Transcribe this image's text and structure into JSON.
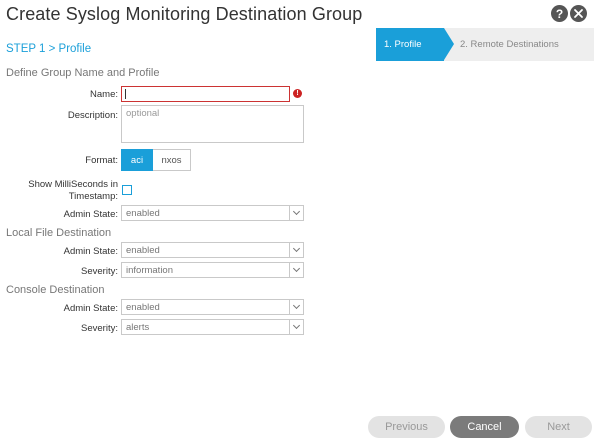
{
  "dialog": {
    "title": "Create Syslog Monitoring Destination Group",
    "help_icon": "?",
    "close_icon": "x-circle"
  },
  "wizard": {
    "steps": [
      {
        "label": "1. Profile",
        "active": true
      },
      {
        "label": "2. Remote Destinations",
        "active": false
      }
    ],
    "breadcrumb": "STEP 1 > Profile"
  },
  "sections": {
    "group": "Define Group Name and Profile",
    "local_file": "Local File Destination",
    "console": "Console Destination"
  },
  "form": {
    "name": {
      "label": "Name:",
      "value": "",
      "error": "!"
    },
    "description": {
      "label": "Description:",
      "placeholder": "optional"
    },
    "format": {
      "label": "Format:",
      "options": [
        "aci",
        "nxos"
      ],
      "selected": "aci"
    },
    "show_ms": {
      "label_line1": "Show MilliSeconds in",
      "label_line2": "Timestamp:",
      "checked": false
    },
    "admin_state": {
      "label": "Admin State:",
      "value": "enabled"
    },
    "local_admin_state": {
      "label": "Admin State:",
      "value": "enabled"
    },
    "local_severity": {
      "label": "Severity:",
      "value": "information"
    },
    "console_admin_state": {
      "label": "Admin State:",
      "value": "enabled"
    },
    "console_severity": {
      "label": "Severity:",
      "value": "alerts"
    }
  },
  "footer": {
    "previous": "Previous",
    "cancel": "Cancel",
    "next": "Next"
  },
  "colors": {
    "accent": "#1a9fd9",
    "error": "#cc2222",
    "cancel_bg": "#7b7b7b"
  }
}
